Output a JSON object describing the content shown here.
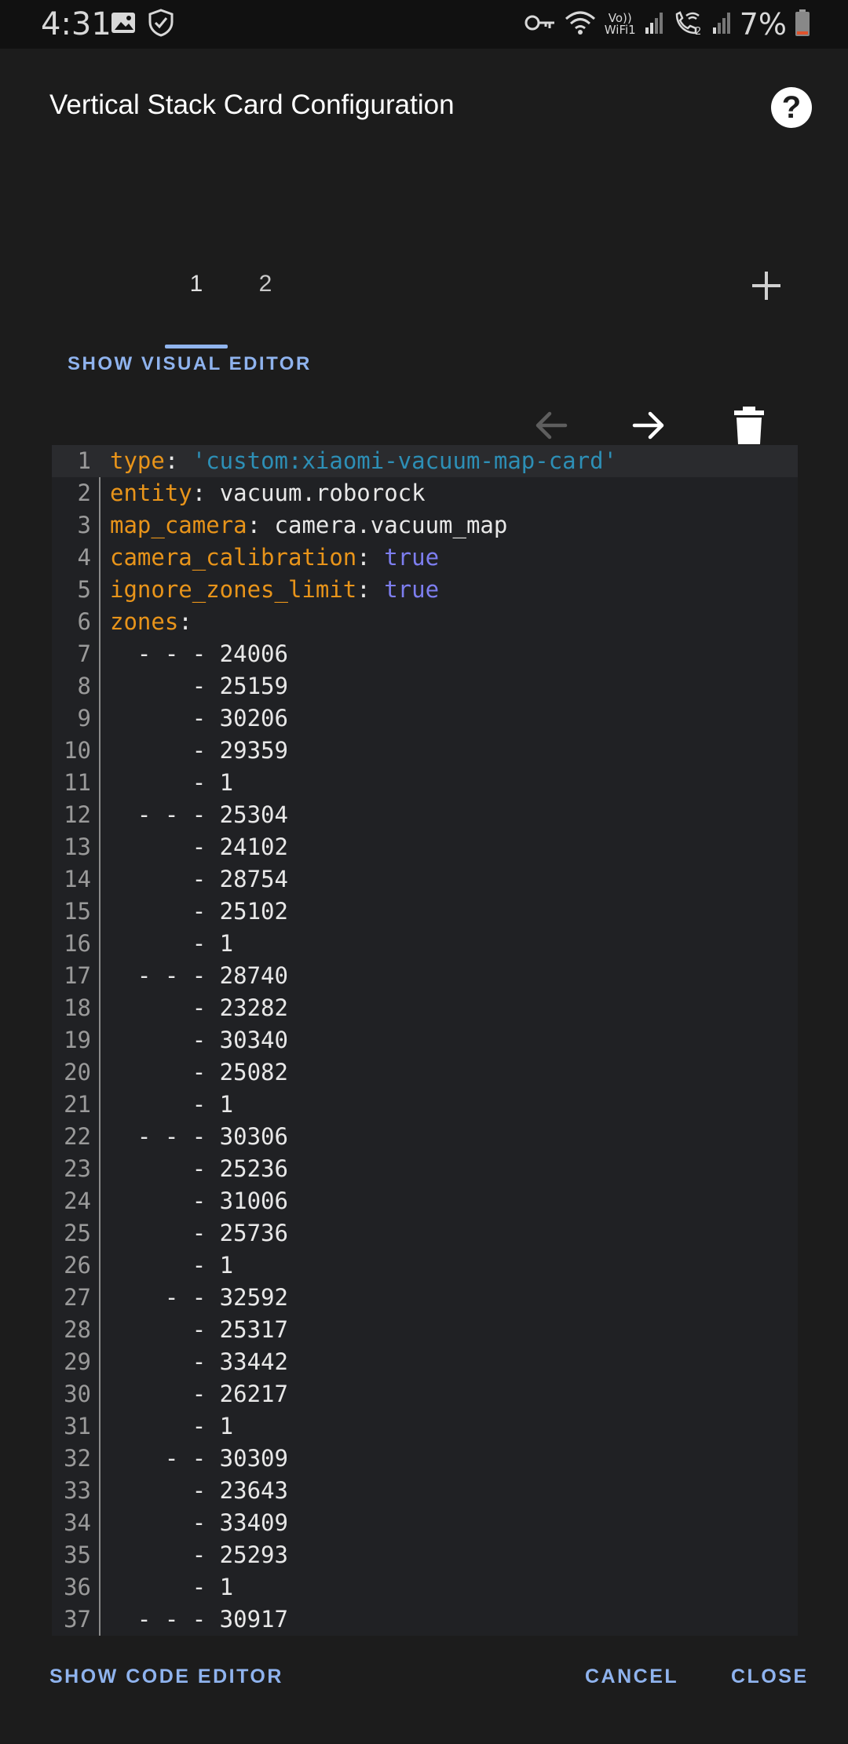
{
  "status_bar": {
    "time": "4:31",
    "battery": "7%",
    "volte": "Vo))",
    "wifi_label": "WiFi1",
    "sim2": "2"
  },
  "dialog": {
    "title": "Vertical Stack Card Configuration",
    "tabs": [
      {
        "label": "1"
      },
      {
        "label": "2"
      }
    ],
    "active_tab": "1",
    "show_visual_editor": "SHOW VISUAL EDITOR",
    "footer": {
      "show_code_editor": "SHOW CODE EDITOR",
      "cancel": "CANCEL",
      "close": "CLOSE"
    }
  },
  "colors": {
    "accent": "#8fb3ee",
    "yaml_key": "#e8941a",
    "yaml_string": "#2d8fb6",
    "yaml_bool": "#7d7ef0"
  },
  "code_lines": [
    {
      "n": "1",
      "key": "type",
      "sep": ": ",
      "val": "'custom:xiaomi-vacuum-map-card'",
      "vtype": "s"
    },
    {
      "n": "2",
      "key": "entity",
      "sep": ": ",
      "val": "vacuum.roborock",
      "vtype": "p"
    },
    {
      "n": "3",
      "key": "map_camera",
      "sep": ": ",
      "val": "camera.vacuum_map",
      "vtype": "p"
    },
    {
      "n": "4",
      "key": "camera_calibration",
      "sep": ": ",
      "val": "true",
      "vtype": "b"
    },
    {
      "n": "5",
      "key": "ignore_zones_limit",
      "sep": ": ",
      "val": "true",
      "vtype": "b"
    },
    {
      "n": "6",
      "key": "zones",
      "sep": ":",
      "val": "",
      "vtype": "p"
    },
    {
      "n": "7",
      "text": "  - - - 24006"
    },
    {
      "n": "8",
      "text": "      - 25159"
    },
    {
      "n": "9",
      "text": "      - 30206"
    },
    {
      "n": "10",
      "text": "      - 29359"
    },
    {
      "n": "11",
      "text": "      - 1"
    },
    {
      "n": "12",
      "text": "  - - - 25304"
    },
    {
      "n": "13",
      "text": "      - 24102"
    },
    {
      "n": "14",
      "text": "      - 28754"
    },
    {
      "n": "15",
      "text": "      - 25102"
    },
    {
      "n": "16",
      "text": "      - 1"
    },
    {
      "n": "17",
      "text": "  - - - 28740"
    },
    {
      "n": "18",
      "text": "      - 23282"
    },
    {
      "n": "19",
      "text": "      - 30340"
    },
    {
      "n": "20",
      "text": "      - 25082"
    },
    {
      "n": "21",
      "text": "      - 1"
    },
    {
      "n": "22",
      "text": "  - - - 30306"
    },
    {
      "n": "23",
      "text": "      - 25236"
    },
    {
      "n": "24",
      "text": "      - 31006"
    },
    {
      "n": "25",
      "text": "      - 25736"
    },
    {
      "n": "26",
      "text": "      - 1"
    },
    {
      "n": "27",
      "text": "    - - 32592"
    },
    {
      "n": "28",
      "text": "      - 25317"
    },
    {
      "n": "29",
      "text": "      - 33442"
    },
    {
      "n": "30",
      "text": "      - 26217"
    },
    {
      "n": "31",
      "text": "      - 1"
    },
    {
      "n": "32",
      "text": "    - - 30309"
    },
    {
      "n": "33",
      "text": "      - 23643"
    },
    {
      "n": "34",
      "text": "      - 33409"
    },
    {
      "n": "35",
      "text": "      - 25293"
    },
    {
      "n": "36",
      "text": "      - 1"
    },
    {
      "n": "37",
      "text": "  - - - 30917"
    }
  ]
}
